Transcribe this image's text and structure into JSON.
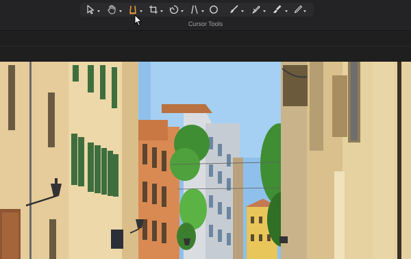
{
  "toolbar": {
    "caption": "Cursor Tools",
    "accent": "#e39a3a",
    "tools": [
      {
        "id": "select",
        "icon": "arrow-select-icon",
        "has_menu": true,
        "active": false
      },
      {
        "id": "hand",
        "icon": "hand-icon",
        "has_menu": true,
        "active": false
      },
      {
        "id": "trim",
        "icon": "trim-icon",
        "has_menu": true,
        "active": true
      },
      {
        "id": "crop",
        "icon": "crop-icon",
        "has_menu": true,
        "active": false
      },
      {
        "id": "retime",
        "icon": "speedometer-icon",
        "has_menu": true,
        "active": false
      },
      {
        "id": "distort",
        "icon": "distort-icon",
        "has_menu": true,
        "active": false
      },
      {
        "id": "circle",
        "icon": "circle-icon",
        "has_menu": false,
        "active": false
      },
      {
        "id": "brush",
        "icon": "brush-icon",
        "has_menu": true,
        "active": false
      },
      {
        "id": "pen",
        "icon": "pen-icon",
        "has_menu": true,
        "active": false
      },
      {
        "id": "marker",
        "icon": "marker-icon",
        "has_menu": true,
        "active": false
      },
      {
        "id": "pencil",
        "icon": "pencil-icon",
        "has_menu": true,
        "active": false
      }
    ]
  },
  "viewer": {
    "sky_color": "#8fc0ec",
    "facade_color": "#e5cc9a",
    "shutter_color": "#3f6e3e"
  }
}
